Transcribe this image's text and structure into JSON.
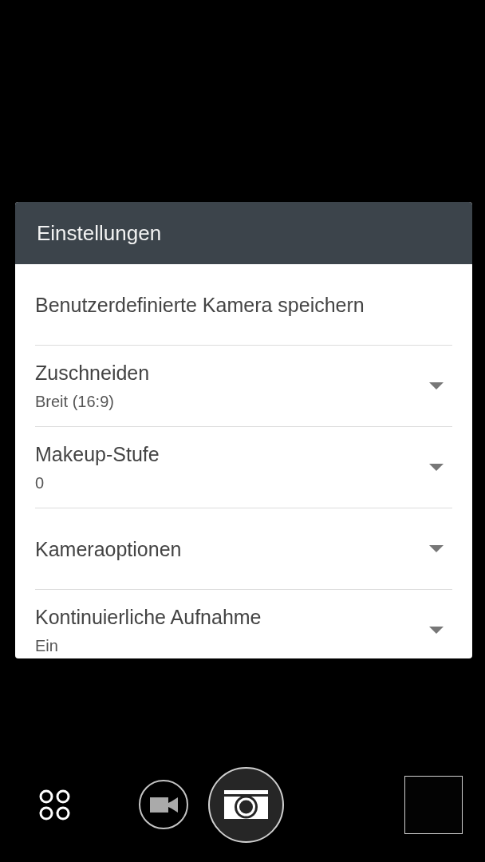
{
  "dialog": {
    "title": "Einstellungen",
    "items": [
      {
        "kind": "action",
        "label": "Benutzerdefinierte Kamera speichern"
      },
      {
        "kind": "dropdown",
        "label": "Zuschneiden",
        "value": "Breit (16:9)"
      },
      {
        "kind": "dropdown",
        "label": "Makeup-Stufe",
        "value": "0"
      },
      {
        "kind": "dropdown",
        "label": "Kameraoptionen"
      },
      {
        "kind": "dropdown",
        "label": "Kontinuierliche Aufnahme",
        "value": "Ein"
      }
    ]
  },
  "camera_bar": {
    "buttons": [
      {
        "kind": "grid"
      },
      {
        "kind": "video"
      },
      {
        "kind": "shutter"
      },
      {
        "kind": "thumbnail"
      }
    ]
  }
}
